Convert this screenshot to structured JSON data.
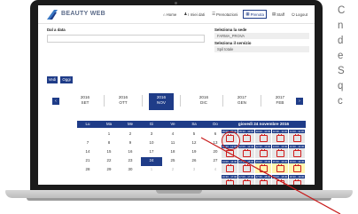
{
  "app": {
    "logo_text": "BEAUTY WEB",
    "nav": [
      {
        "label": "Home",
        "icon": "home-icon",
        "glyph": "⌂",
        "active": false
      },
      {
        "label": "I miei dati",
        "icon": "user-icon",
        "glyph": "♟",
        "active": false
      },
      {
        "label": "Prenotazioni",
        "icon": "list-icon",
        "glyph": "☰",
        "active": false
      },
      {
        "label": "Prenota",
        "icon": "calendar-icon",
        "glyph": "▦",
        "active": true
      },
      {
        "label": "Staff",
        "icon": "staff-icon",
        "glyph": "▤",
        "active": false
      },
      {
        "label": "Logout",
        "icon": "logout-icon",
        "glyph": "⏻",
        "active": false
      }
    ]
  },
  "form": {
    "date_label": "Dal a data",
    "sede_label": "Seleziona la sede",
    "sede_value": "FARMA_PROVA",
    "servizio_label": "Seleziona il servizio",
    "servizio_value": "Spil totale",
    "btn_vedi": "Vedi",
    "btn_oggi": "Oggi"
  },
  "months": [
    {
      "year": "2016",
      "name": "SET",
      "selected": false
    },
    {
      "year": "2016",
      "name": "OTT",
      "selected": false
    },
    {
      "year": "2016",
      "name": "NOV",
      "selected": true
    },
    {
      "year": "2016",
      "name": "DIC",
      "selected": false
    },
    {
      "year": "2017",
      "name": "GEN",
      "selected": false
    },
    {
      "year": "2017",
      "name": "FEB",
      "selected": false
    }
  ],
  "prev_glyph": "‹",
  "next_glyph": "›",
  "calendar": {
    "weekdays": [
      "Lu",
      "Ma",
      "Me",
      "Gi",
      "Ve",
      "Sa",
      "Do"
    ],
    "weeks": [
      [
        "",
        "1",
        "2",
        "3",
        "4",
        "5",
        "6"
      ],
      [
        "7",
        "8",
        "9",
        "10",
        "11",
        "12",
        "13"
      ],
      [
        "14",
        "15",
        "16",
        "17",
        "18",
        "19",
        "20"
      ],
      [
        "21",
        "22",
        "23",
        "24",
        "25",
        "26",
        "27"
      ],
      [
        "28",
        "29",
        "30",
        "1",
        "2",
        "3",
        "4"
      ]
    ],
    "selected_day": "24"
  },
  "day_panel": {
    "title": "giovedì 24 novembre 2016",
    "rows": [
      {
        "times": [
          "09:00 - 09:30",
          "09:30 - 10:00",
          "10:00 - 10:30",
          "10:30 - 11:00",
          "11:00 - 11:30"
        ],
        "avail": [
          false,
          false,
          false,
          false,
          false
        ]
      },
      {
        "times": [
          "11:30 - 12:00",
          "12:00 - 12:30",
          "12:30 - 13:00",
          "13:00 - 13:30",
          "13:30 - 14:00"
        ],
        "avail": [
          false,
          false,
          false,
          false,
          false
        ]
      },
      {
        "times": [
          "14:00 - 14:30",
          "14:30 - 15:00",
          "15:00 - 15:30",
          "15:30 - 16:00",
          "16:00 - 16:30"
        ],
        "avail": [
          false,
          false,
          true,
          true,
          true
        ]
      },
      {
        "times": [
          "16:30 - 17:00",
          "17:00 - 17:30",
          "17:30 - 18:00",
          "18:00 - 18:30",
          "18:30 - 19:00"
        ],
        "avail": [
          false,
          false,
          false,
          false,
          false
        ]
      }
    ]
  },
  "side_text": [
    "C",
    "n",
    "d",
    "e",
    "S",
    "q",
    "c"
  ],
  "colors": {
    "primary": "#1f3c88",
    "highlight": "#c81a1a",
    "available": "#fff6b0"
  }
}
